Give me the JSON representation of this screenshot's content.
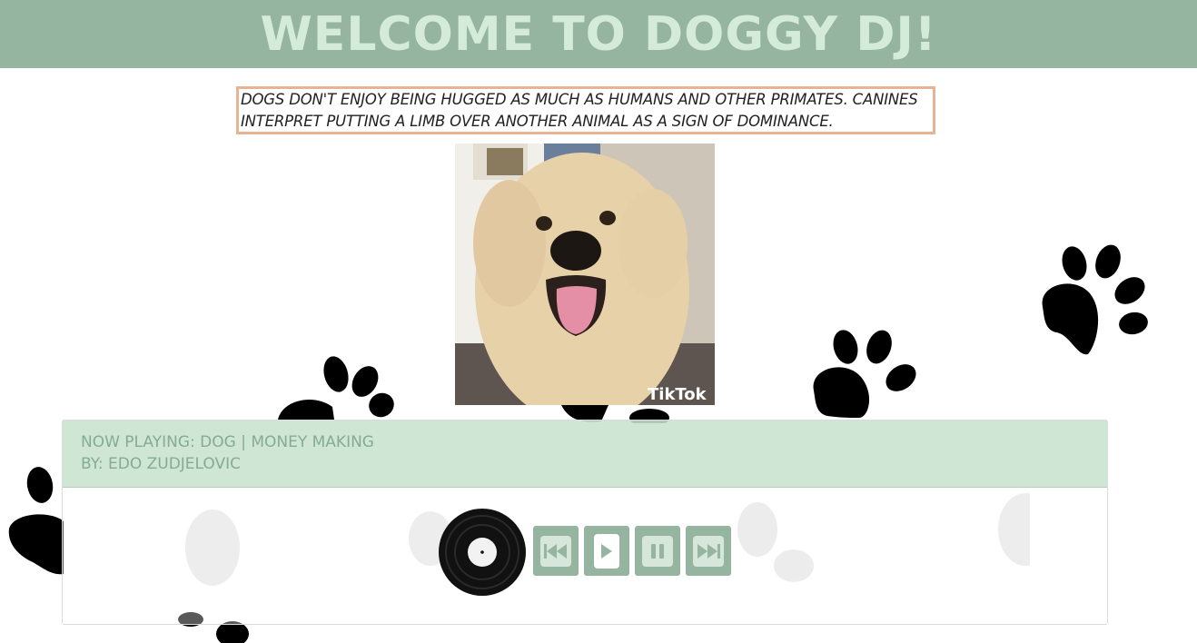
{
  "header": {
    "title": "WELCOME TO DOGGY DJ!"
  },
  "fact": {
    "text": "DOGS DON'T ENJOY BEING HUGGED AS MUCH AS HUMANS AND OTHER PRIMATES. CANINES INTERPRET PUTTING A LIMB OVER ANOTHER ANIMAL AS A SIGN OF DOMINANCE."
  },
  "photo": {
    "watermark": "TikTok"
  },
  "player": {
    "now_playing": "NOW PLAYING: DOG | MONEY MAKING",
    "artist": "BY: EDO ZUDJELOVIC",
    "controls": [
      "previous-icon",
      "play-icon",
      "pause-icon",
      "next-icon"
    ]
  },
  "colors": {
    "header_bg": "#95b5a0",
    "header_text": "#d4ebd9",
    "fact_border": "#e8b394",
    "player_head_bg": "#c4e0cb",
    "control_bg": "#95b5a0"
  }
}
